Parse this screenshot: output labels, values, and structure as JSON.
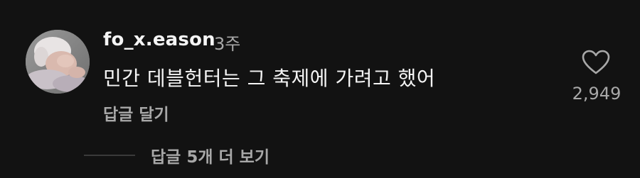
{
  "comment": {
    "avatar_icon": "profile-photo",
    "username": "fo_x.eason",
    "timestamp": "3주",
    "text": "민간 데블헌터는 그 축제에 가려고 했어",
    "reply_label": "답글 달기",
    "like_icon": "heart-outline-icon",
    "like_count": "2,949"
  },
  "replies": {
    "view_label": "답글 5개 더 보기"
  },
  "colors": {
    "background": "#121212",
    "primary_text": "#f5f5f5",
    "secondary_text": "#a8a8a8",
    "divider": "#3a3a3a"
  }
}
